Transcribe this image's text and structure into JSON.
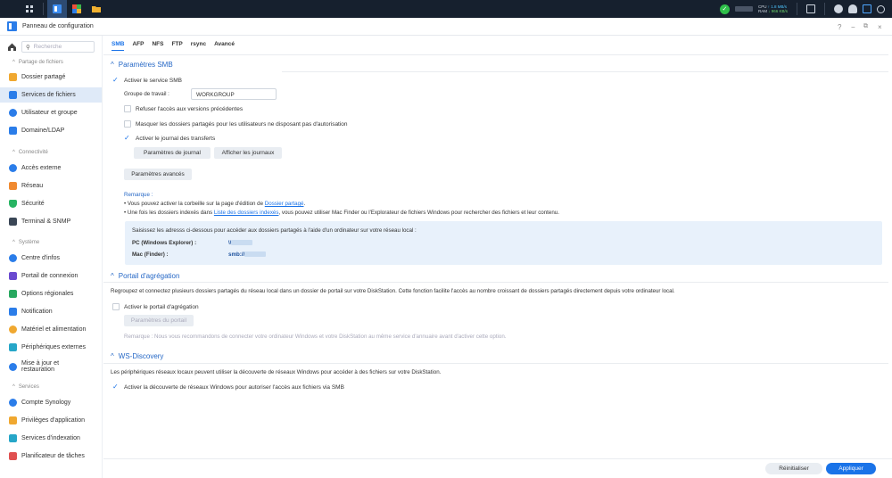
{
  "window": {
    "title": "Panneau de configuration"
  },
  "taskbar": {
    "stats": [
      {
        "label": "CPU",
        "up": "↑ 1.8 MB/s"
      },
      {
        "label": "RAM",
        "up": "↓ 966 KB/s"
      }
    ]
  },
  "sidebar": {
    "search_placeholder": "Recherche",
    "sections": {
      "files": "Partage de fichiers",
      "connectivity": "Connectivité",
      "system": "Système",
      "services": "Services"
    },
    "items": [
      {
        "label": "Dossier partagé",
        "color": "#f0a830"
      },
      {
        "label": "Services de fichiers",
        "color": "#2b7de9"
      },
      {
        "label": "Utilisateur et groupe",
        "color": "#2b7de9"
      },
      {
        "label": "Domaine/LDAP",
        "color": "#2b7de9"
      },
      {
        "label": "Accès externe",
        "color": "#2b7de9"
      },
      {
        "label": "Réseau",
        "color": "#f08a30"
      },
      {
        "label": "Sécurité",
        "color": "#28b463"
      },
      {
        "label": "Terminal & SNMP",
        "color": "#3a4656"
      },
      {
        "label": "Centre d'infos",
        "color": "#2b7de9"
      },
      {
        "label": "Portail de connexion",
        "color": "#6a4ad0"
      },
      {
        "label": "Options régionales",
        "color": "#28a860"
      },
      {
        "label": "Notification",
        "color": "#2b7de9"
      },
      {
        "label": "Matériel et alimentation",
        "color": "#f0a830"
      },
      {
        "label": "Périphériques externes",
        "color": "#26a6c8"
      },
      {
        "label": "Mise à jour et restauration",
        "color": "#2b7de9"
      },
      {
        "label": "Compte Synology",
        "color": "#2b7de9"
      },
      {
        "label": "Privilèges d'application",
        "color": "#f0a830"
      },
      {
        "label": "Services d'indexation",
        "color": "#26a6c8"
      },
      {
        "label": "Planificateur de tâches",
        "color": "#e05050"
      }
    ]
  },
  "tabs": [
    "SMB",
    "AFP",
    "NFS",
    "FTP",
    "rsync",
    "Avancé"
  ],
  "smb": {
    "header": "Paramètres SMB",
    "enable": "Activer le service SMB",
    "workgroup_label": "Groupe de travail :",
    "workgroup_value": "WORKGROUP",
    "refuse": "Refuser l'accès aux versions précédentes",
    "mask": "Masquer les dossiers partagés pour les utilisateurs ne disposant pas d'autorisation",
    "log": "Activer le journal des transferts",
    "log_settings": "Paramètres de journal",
    "show_logs": "Afficher les journaux",
    "advanced": "Paramètres avancés",
    "note_title": "Remarque :",
    "note1_a": "• Vous pouvez activer la corbeille sur la page d'édition de ",
    "note1_link": "Dossier partagé",
    "note1_b": ".",
    "note2_a": "• Une fois les dossiers indexés dans ",
    "note2_link": "Liste des dossiers indexés",
    "note2_b": ", vous pouvez utiliser Mac Finder ou l'Explorateur de fichiers Windows pour rechercher des fichiers et leur contenu.",
    "info_title": "Saisissez les adresss ci-dessous pour accéder aux dossiers partagés à l'aide d'un ordinateur sur votre réseau local :",
    "pc_label": "PC (Windows Explorer) :",
    "pc_value": "\\\\",
    "mac_label": "Mac (Finder) :",
    "mac_value": "smb://"
  },
  "portal": {
    "header": "Portail d'agrégation",
    "desc": "Regroupez et connectez plusieurs dossiers partagés du réseau local dans un dossier de portail sur votre DiskStation. Cette fonction facilite l'accès au nombre croissant de dossiers partagés directement depuis votre ordinateur local.",
    "enable": "Activer le portail d'agrégation",
    "settings": "Paramètres du portail",
    "note": "Remarque : Nous vous recommandons de connecter votre ordinateur Windows et votre DiskStation au même service d'annuaire avant d'activer cette option."
  },
  "ws": {
    "header": "WS-Discovery",
    "desc": "Les périphériques réseaux locaux peuvent utiliser la découverte de réseaux Windows pour accéder à des fichiers sur votre DiskStation.",
    "enable": "Activer la découverte de réseaux Windows pour autoriser l'accès aux fichiers via SMB"
  },
  "footer": {
    "reset": "Réinitialiser",
    "apply": "Appliquer"
  }
}
